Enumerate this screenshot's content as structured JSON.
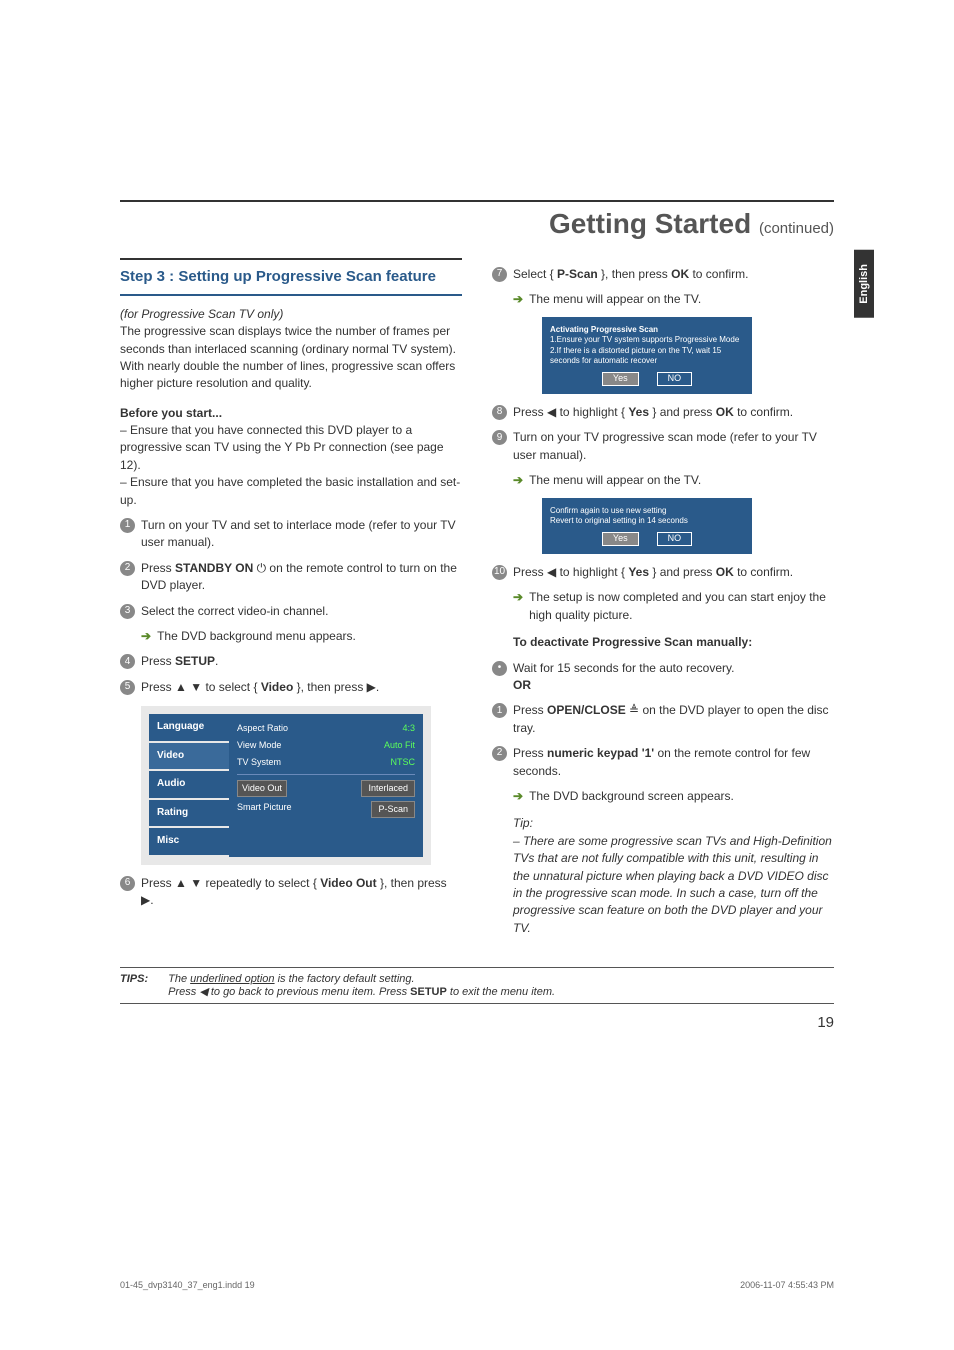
{
  "side_tab": "English",
  "main_title": "Getting Started",
  "main_title_cont": "(continued)",
  "section_title": "Step 3 : Setting up Progressive Scan feature",
  "left": {
    "italic_note": "(for Progressive Scan TV only)",
    "intro": "The progressive scan displays twice the number of frames per seconds than interlaced scanning (ordinary normal TV system). With nearly double the number of lines, progressive scan offers higher picture resolution and quality.",
    "before_title": "Before you start...",
    "before_1": "– Ensure that you have connected this DVD player to a progressive scan TV using the Y Pb Pr connection (see page 12).",
    "before_2": "– Ensure that you have completed the basic installation and set-up.",
    "step1": "Turn on your TV and set to interlace mode (refer to your TV user manual).",
    "step2_a": "Press ",
    "step2_b": "STANDBY ON",
    "step2_c": " on the remote control to turn on the DVD player.",
    "step3": "Select the correct video-in channel.",
    "step3_arrow": "The DVD background menu appears.",
    "step4_a": "Press ",
    "step4_b": "SETUP",
    "step4_c": ".",
    "step5_a": "Press ",
    "step5_b": " to select { ",
    "step5_c": "Video",
    "step5_d": " }, then press ",
    "step5_e": ".",
    "step6_a": "Press ",
    "step6_b": " repeatedly to select { ",
    "step6_c": "Video Out",
    "step6_d": " }, then press ",
    "step6_e": "."
  },
  "menu": {
    "language": "Language",
    "video": "Video",
    "audio": "Audio",
    "rating": "Rating",
    "misc": "Misc",
    "aspect": "Aspect Ratio",
    "aspect_v": "4:3",
    "view": "View Mode",
    "view_v": "Auto Fit",
    "tvsys": "TV System",
    "tvsys_v": "NTSC",
    "vout": "Video Out",
    "vout_v1": "Interlaced",
    "smart": "Smart Picture",
    "vout_v2": "P-Scan"
  },
  "right": {
    "step7_a": "Select { ",
    "step7_b": "P-Scan",
    "step7_c": " }, then press ",
    "step7_d": "OK",
    "step7_e": " to confirm.",
    "step7_arrow": "The menu will appear on the TV.",
    "popup1_l1": "Activating Progressive Scan",
    "popup1_l2": "1.Ensure your TV system supports Progressive Mode",
    "popup1_l3": "2.If there is a distorted picture on the TV, wait 15 seconds for automatic recover",
    "yes": "Yes",
    "no": "NO",
    "step8_a": "Press ",
    "step8_b": " to highlight { ",
    "step8_c": "Yes",
    "step8_d": " } and press ",
    "step8_e": "OK",
    "step8_f": " to confirm.",
    "step9": "Turn on your TV progressive scan mode (refer to your TV user manual).",
    "step9_arrow": "The menu will appear on the TV.",
    "popup2_l1": "Confirm again to use new setting",
    "popup2_l2": "Revert to original setting in 14 seconds",
    "step10_a": "Press ",
    "step10_b": " to highlight { ",
    "step10_c": "Yes",
    "step10_d": " } and press ",
    "step10_e": "OK",
    "step10_f": " to confirm.",
    "step10_arrow": "The setup is now completed and you can start enjoy the high quality picture.",
    "deact_title": "To deactivate Progressive Scan manually:",
    "wait": "Wait for 15 seconds for the auto recovery.",
    "or": "OR",
    "d1_a": "Press ",
    "d1_b": "OPEN/CLOSE",
    "d1_c": " on the DVD player to open the disc tray.",
    "d2_a": "Press ",
    "d2_b": "numeric keypad '1'",
    "d2_c": " on the remote control for few seconds.",
    "d2_arrow": "The DVD background screen appears.",
    "tip_title": "Tip:",
    "tip_body": "– There are some progressive scan TVs and High-Definition TVs that are not fully compatible with this unit, resulting in the unnatural picture when playing back a DVD VIDEO disc in the progressive scan mode. In such a case, turn off the progressive scan feature on both the DVD player and your TV."
  },
  "tips": {
    "label": "TIPS:",
    "l1_a": "The ",
    "l1_b": "underlined option",
    "l1_c": " is the factory default setting.",
    "l2_a": "Press ",
    "l2_b": " to go back to previous menu item. Press ",
    "l2_c": "SETUP",
    "l2_d": " to exit the menu item."
  },
  "page_num": "19",
  "footer_left": "01-45_dvp3140_37_eng1.indd   19",
  "footer_right": "2006-11-07   4:55:43 PM"
}
